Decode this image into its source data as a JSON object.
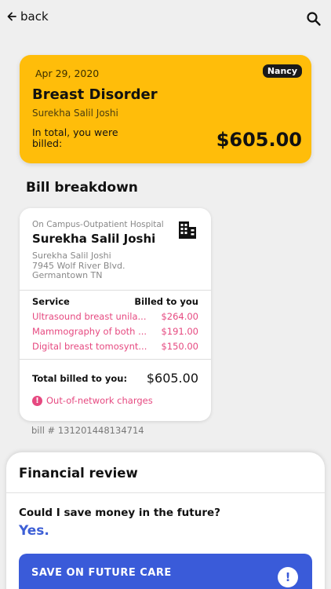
{
  "header": {
    "back_label": "back",
    "back_icon": "arrow-left-icon",
    "search_icon": "search-icon"
  },
  "summary": {
    "date": "Apr 29, 2020",
    "badge": "Nancy",
    "title": "Breast Disorder",
    "patient": "Surekha Salil Joshi",
    "billed_label": "In total, you were billed:",
    "amount": "$605.00",
    "color": "#ffbd0a"
  },
  "breakdown": {
    "title": "Bill breakdown",
    "provider": "On Campus-Outpatient Hospital",
    "provider_icon": "building-icon",
    "patient": "Surekha Salil Joshi",
    "address_lines": [
      "Surekha Salil Joshi",
      "7945 Wolf River Blvd.",
      "Germantown TN"
    ],
    "service_header": "Service",
    "billed_header": "Billed to you",
    "services": [
      {
        "name": "Ultrasound breast unila...",
        "amount": "$264.00"
      },
      {
        "name": "Mammography of both ...",
        "amount": "$191.00"
      },
      {
        "name": "Digital breast tomosynt...",
        "amount": "$150.00"
      }
    ],
    "total_label": "Total billed to you:",
    "total_value": "$605.00",
    "out_of_network": "Out-of-network charges",
    "out_of_network_icon": "alert-icon",
    "accent": "#e64980"
  },
  "bill_number": "bill # 131201448134714",
  "financial_review": {
    "title": "Financial review",
    "question": "Could I save money in the future?",
    "answer": "Yes.",
    "cta_label": "SAVE ON FUTURE CARE",
    "cta_icon": "!",
    "cta_color": "#3a5bd9"
  }
}
